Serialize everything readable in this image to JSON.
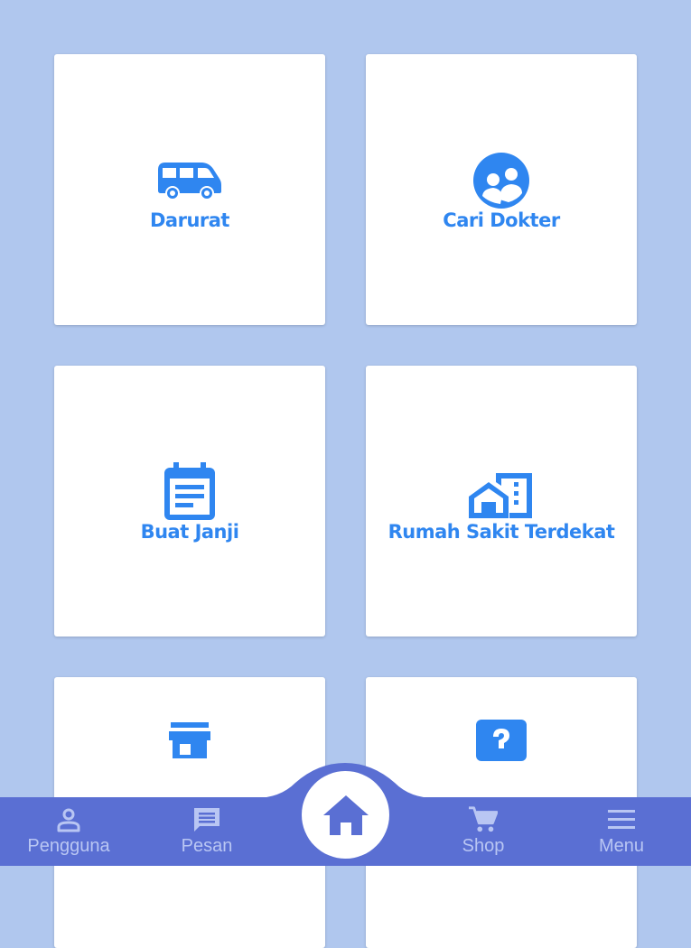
{
  "cards": [
    {
      "label": "Darurat",
      "icon": "ambulance-van-icon"
    },
    {
      "label": "Cari Dokter",
      "icon": "people-icon"
    },
    {
      "label": "Buat Janji",
      "icon": "calendar-note-icon"
    },
    {
      "label": "Rumah Sakit Terdekat",
      "icon": "home-building-icon"
    },
    {
      "label": "",
      "icon": "store-icon"
    },
    {
      "label": "",
      "icon": "help-icon"
    }
  ],
  "bottom_nav": {
    "items": [
      {
        "label": "Pengguna",
        "icon": "person-icon"
      },
      {
        "label": "Pesan",
        "icon": "message-icon"
      },
      {
        "label": "",
        "icon": "home-icon"
      },
      {
        "label": "Shop",
        "icon": "cart-icon"
      },
      {
        "label": "Menu",
        "icon": "menu-icon"
      }
    ]
  },
  "colors": {
    "background": "#b0c7ee",
    "accent": "#2f86f0",
    "navbar": "#5a6fd3",
    "nav_label": "#b9c6f3",
    "home_icon": "#5a6fd3"
  }
}
